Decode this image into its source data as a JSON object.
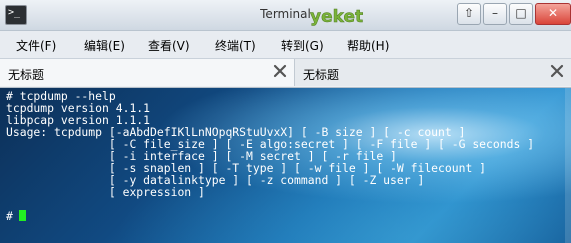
{
  "window": {
    "title": "Terminal"
  },
  "menu": [
    {
      "label": "文件(F)"
    },
    {
      "label": "编辑(E)"
    },
    {
      "label": "查看(V)"
    },
    {
      "label": "终端(T)"
    },
    {
      "label": "转到(G)"
    },
    {
      "label": "帮助(H)"
    }
  ],
  "tabs": [
    {
      "label": "无标题"
    },
    {
      "label": "无标题"
    }
  ],
  "terminal": {
    "lines": [
      "# tcpdump --help",
      "tcpdump version 4.1.1",
      "libpcap version 1.1.1",
      "Usage: tcpdump [-aAbdDefIKlLnNOpqRStuUvxX] [ -B size ] [ -c count ]",
      "               [ -C file_size ] [ -E algo:secret ] [ -F file ] [ -G seconds ]",
      "               [ -i interface ] [ -M secret ] [ -r file ]",
      "               [ -s snaplen ] [ -T type ] [ -w file ] [ -W filecount ]",
      "               [ -y datalinktype ] [ -z command ] [ -Z user ]",
      "               [ expression ]",
      "",
      "#"
    ]
  },
  "colors": {
    "cursor": "#22ee22",
    "text": "#ffffff"
  },
  "icons": {
    "close_tab": "close-icon"
  }
}
